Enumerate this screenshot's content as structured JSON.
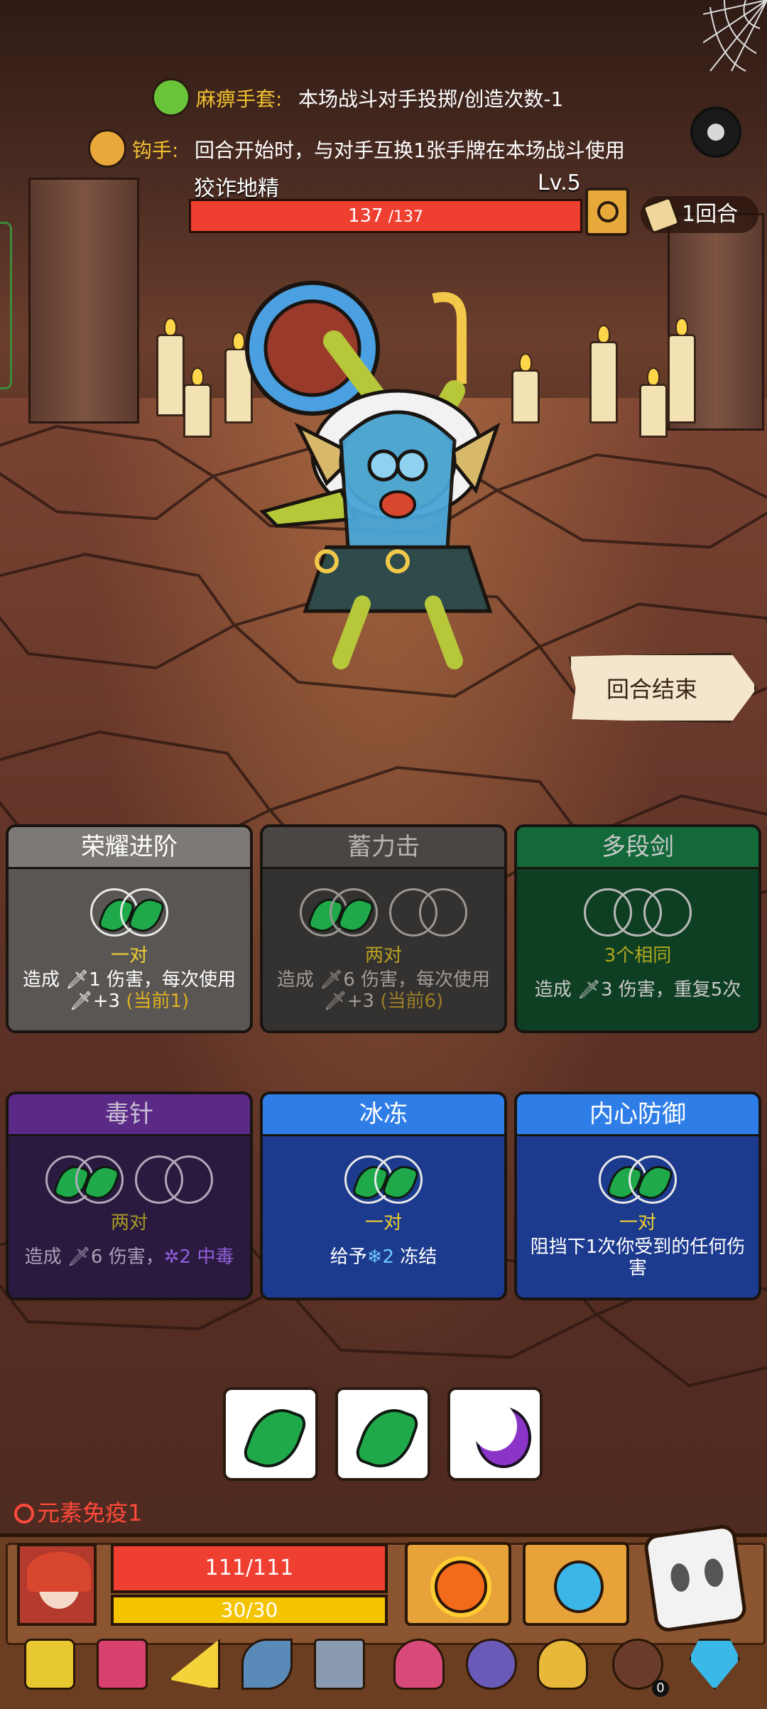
{
  "status_effects": [
    {
      "name": "麻痹手套:",
      "desc": "本场战斗对手投掷/创造次数-1",
      "icon": "green-glove-icon"
    },
    {
      "name": "钩手:",
      "desc": "回合开始时，与对手互换1张手牌在本场战斗使用",
      "icon": "hook-hand-icon"
    }
  ],
  "enemy": {
    "name": "狡诈地精",
    "level": "Lv.5",
    "hp_current": "137",
    "hp_sep": " /",
    "hp_max": "137",
    "hp_fraction": 1.0
  },
  "round": {
    "label": "1回合"
  },
  "end_turn": {
    "label": "回合结束"
  },
  "cards": [
    {
      "title": "荣耀进阶",
      "requirement": "一对",
      "desc": "造成 🗡1 伤害，每次使用🗡+3 ",
      "highlight": "(当前1)",
      "style": "gray",
      "slots_filled": [
        true,
        true
      ]
    },
    {
      "title": "蓄力击",
      "requirement": "两对",
      "desc": "造成 🗡6 伤害，每次使用🗡+3 ",
      "highlight": "(当前6)",
      "style": "dim",
      "slots_filled": [
        true,
        true,
        false,
        false
      ]
    },
    {
      "title": "多段剑",
      "requirement": "3个相同",
      "desc": "造成 🗡3 伤害，重复5次",
      "highlight": "",
      "style": "green",
      "slots_filled": [
        false,
        false,
        false
      ]
    },
    {
      "title": "毒针",
      "requirement": "两对",
      "desc": "造成 🗡6 伤害，",
      "highlight": "2 中毒",
      "style": "purple",
      "slots_filled": [
        true,
        true,
        false,
        false
      ]
    },
    {
      "title": "冰冻",
      "requirement": "一对",
      "desc": "给予",
      "highlight": "2",
      "desc_tail": " 冻结",
      "style": "blue",
      "slots_filled": [
        true,
        true
      ]
    },
    {
      "title": "内心防御",
      "requirement": "一对",
      "desc": "阻挡下1次你受到的任何伤害",
      "highlight": "",
      "style": "blue",
      "slots_filled": [
        true,
        true
      ]
    }
  ],
  "dice_pool": [
    {
      "face": "leaf",
      "color": "#1fa94a"
    },
    {
      "face": "leaf",
      "color": "#1fa94a"
    },
    {
      "face": "moon",
      "color": "#8a35c8"
    }
  ],
  "player": {
    "immunity": "元素免疫1",
    "hp": "111/111",
    "mana": "30/30"
  },
  "relics": [
    {
      "icon": "crown-icon",
      "color": "#e8c830"
    },
    {
      "icon": "totem-icon",
      "color": "#d8406e"
    },
    {
      "icon": "cheese-icon",
      "color": "#f4d23a"
    },
    {
      "icon": "pickaxe-icon",
      "color": "#5a8ab8"
    },
    {
      "icon": "cube-icon",
      "color": "#8a9ab0"
    },
    {
      "icon": "mushroom-icon",
      "color": "#d84a7a"
    },
    {
      "icon": "orb-icon",
      "color": "#6a5ab8"
    },
    {
      "icon": "slime-icon",
      "color": "#e8b83a"
    },
    {
      "icon": "button-icon",
      "color": "#6a3a2a"
    },
    {
      "icon": "gem-icon",
      "color": "#3ab8e8"
    }
  ],
  "relic_counter": "0",
  "colors": {
    "accent_gold": "#f0c030",
    "hp_red": "#ee3f30",
    "mana_yellow": "#f5c400"
  }
}
